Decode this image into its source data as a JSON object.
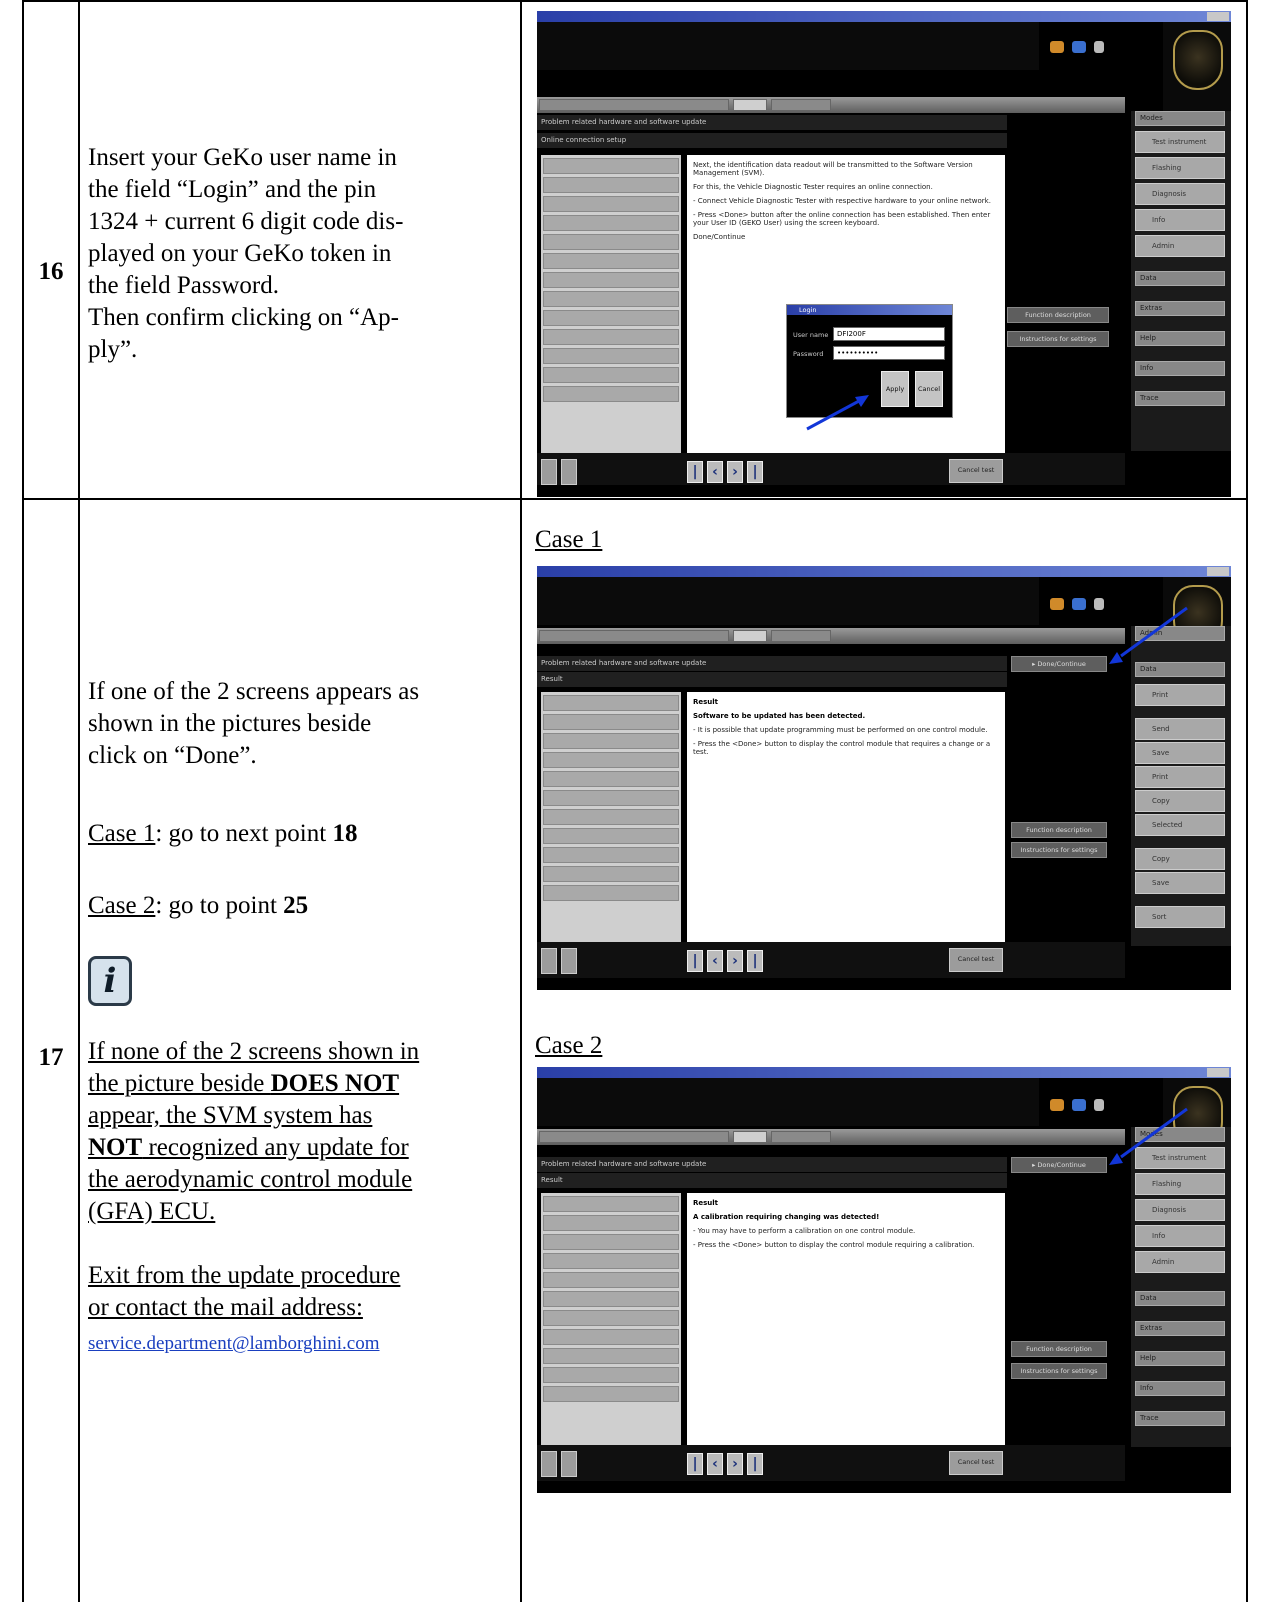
{
  "steps": [
    {
      "number": "16",
      "lines": [
        "Insert your GeKo user name in",
        "the field “Login” and the pin",
        "1324 + current 6 digit code dis-",
        "played on your GeKo token in",
        "the field Password.",
        "Then confirm clicking on “Ap-",
        "ply”."
      ]
    },
    {
      "number": "17",
      "intro_lines": [
        "If one of the 2 screens appears as",
        "shown in the pictures beside",
        "click on “Done”."
      ],
      "case1_label": "Case 1",
      "case1_text": ": go to next point ",
      "case1_point": "18",
      "case2_label": "Case 2",
      "case2_text": ": go to point ",
      "case2_point": "25",
      "info_icon_glyph": "i",
      "warn": {
        "l1": "If none of the 2 screens shown in",
        "l2": "the picture beside ",
        "l2b": "DOES NOT",
        "l3": "appear, the SVM  system has",
        "l4b": "NOT",
        "l4": " recognized any update for",
        "l5": "the aerodynamic control module",
        "l6": "(GFA) ECU."
      },
      "exit_lines": [
        "Exit from the update procedure",
        "or contact the mail address:"
      ],
      "email": "service.department@lamborghini.com",
      "case_headers": [
        "Case 1",
        "Case 2"
      ]
    }
  ],
  "screens": {
    "step16": {
      "panel_title": "Problem related hardware and software update",
      "panel_sub": "Online connection setup",
      "content": [
        "Next, the identification data readout will be transmitted to the Software Version Management (SVM).",
        "For this, the Vehicle Diagnostic Tester requires an online connection.",
        "- Connect Vehicle Diagnostic Tester with respective hardware to your online network.",
        "- Press <Done> button after the online connection has been established. Then enter your User ID (GEKO User) using the screen keyboard.",
        "Done/Continue"
      ],
      "right_buttons": [
        "Function description",
        "Instructions for settings"
      ],
      "side_menu": [
        "Modes",
        "Test instrument",
        "Flashing",
        "Diagnosis",
        "Info",
        "Admin",
        "Data",
        "Extras",
        "Help",
        "Info",
        "Trace"
      ],
      "dialog": {
        "title": "Login",
        "user_label": "User name",
        "user_value": "DFI200F",
        "password_label": "Password",
        "password_value": "••••••••••",
        "apply": "Apply",
        "cancel": "Cancel"
      },
      "cancel_test": "Cancel test"
    },
    "case1": {
      "panel_title": "Problem related hardware and software update",
      "panel_sub": "Result",
      "result_title": "Result",
      "result_bold": "Software to be updated has been detected.",
      "lines": [
        "- It is possible that update programming must be performed on one control module.",
        "- Press the <Done> button to display the control module that requires a change or a test."
      ],
      "done_button": "▸ Done/Continue",
      "right_buttons": [
        "Function description",
        "Instructions for settings"
      ],
      "side_menu": [
        "Admin",
        "Data",
        "Print",
        "Send",
        "Save",
        "Print",
        "Copy",
        "Selected",
        "Copy",
        "Save",
        "Sort"
      ],
      "cancel_test": "Cancel test"
    },
    "case2": {
      "panel_title": "Problem related hardware and software update",
      "panel_sub": "Result",
      "result_title": "Result",
      "result_bold": "A calibration requiring changing was detected!",
      "lines": [
        "- You may have to perform a calibration on one control module.",
        "- Press the <Done> button to display the control module requiring a calibration."
      ],
      "done_button": "▸ Done/Continue",
      "right_buttons": [
        "Function description",
        "Instructions for settings"
      ],
      "side_menu": [
        "Modes",
        "Test instrument",
        "Flashing",
        "Diagnosis",
        "Info",
        "Admin",
        "Data",
        "Extras",
        "Help",
        "Info",
        "Trace"
      ],
      "cancel_test": "Cancel test"
    }
  }
}
